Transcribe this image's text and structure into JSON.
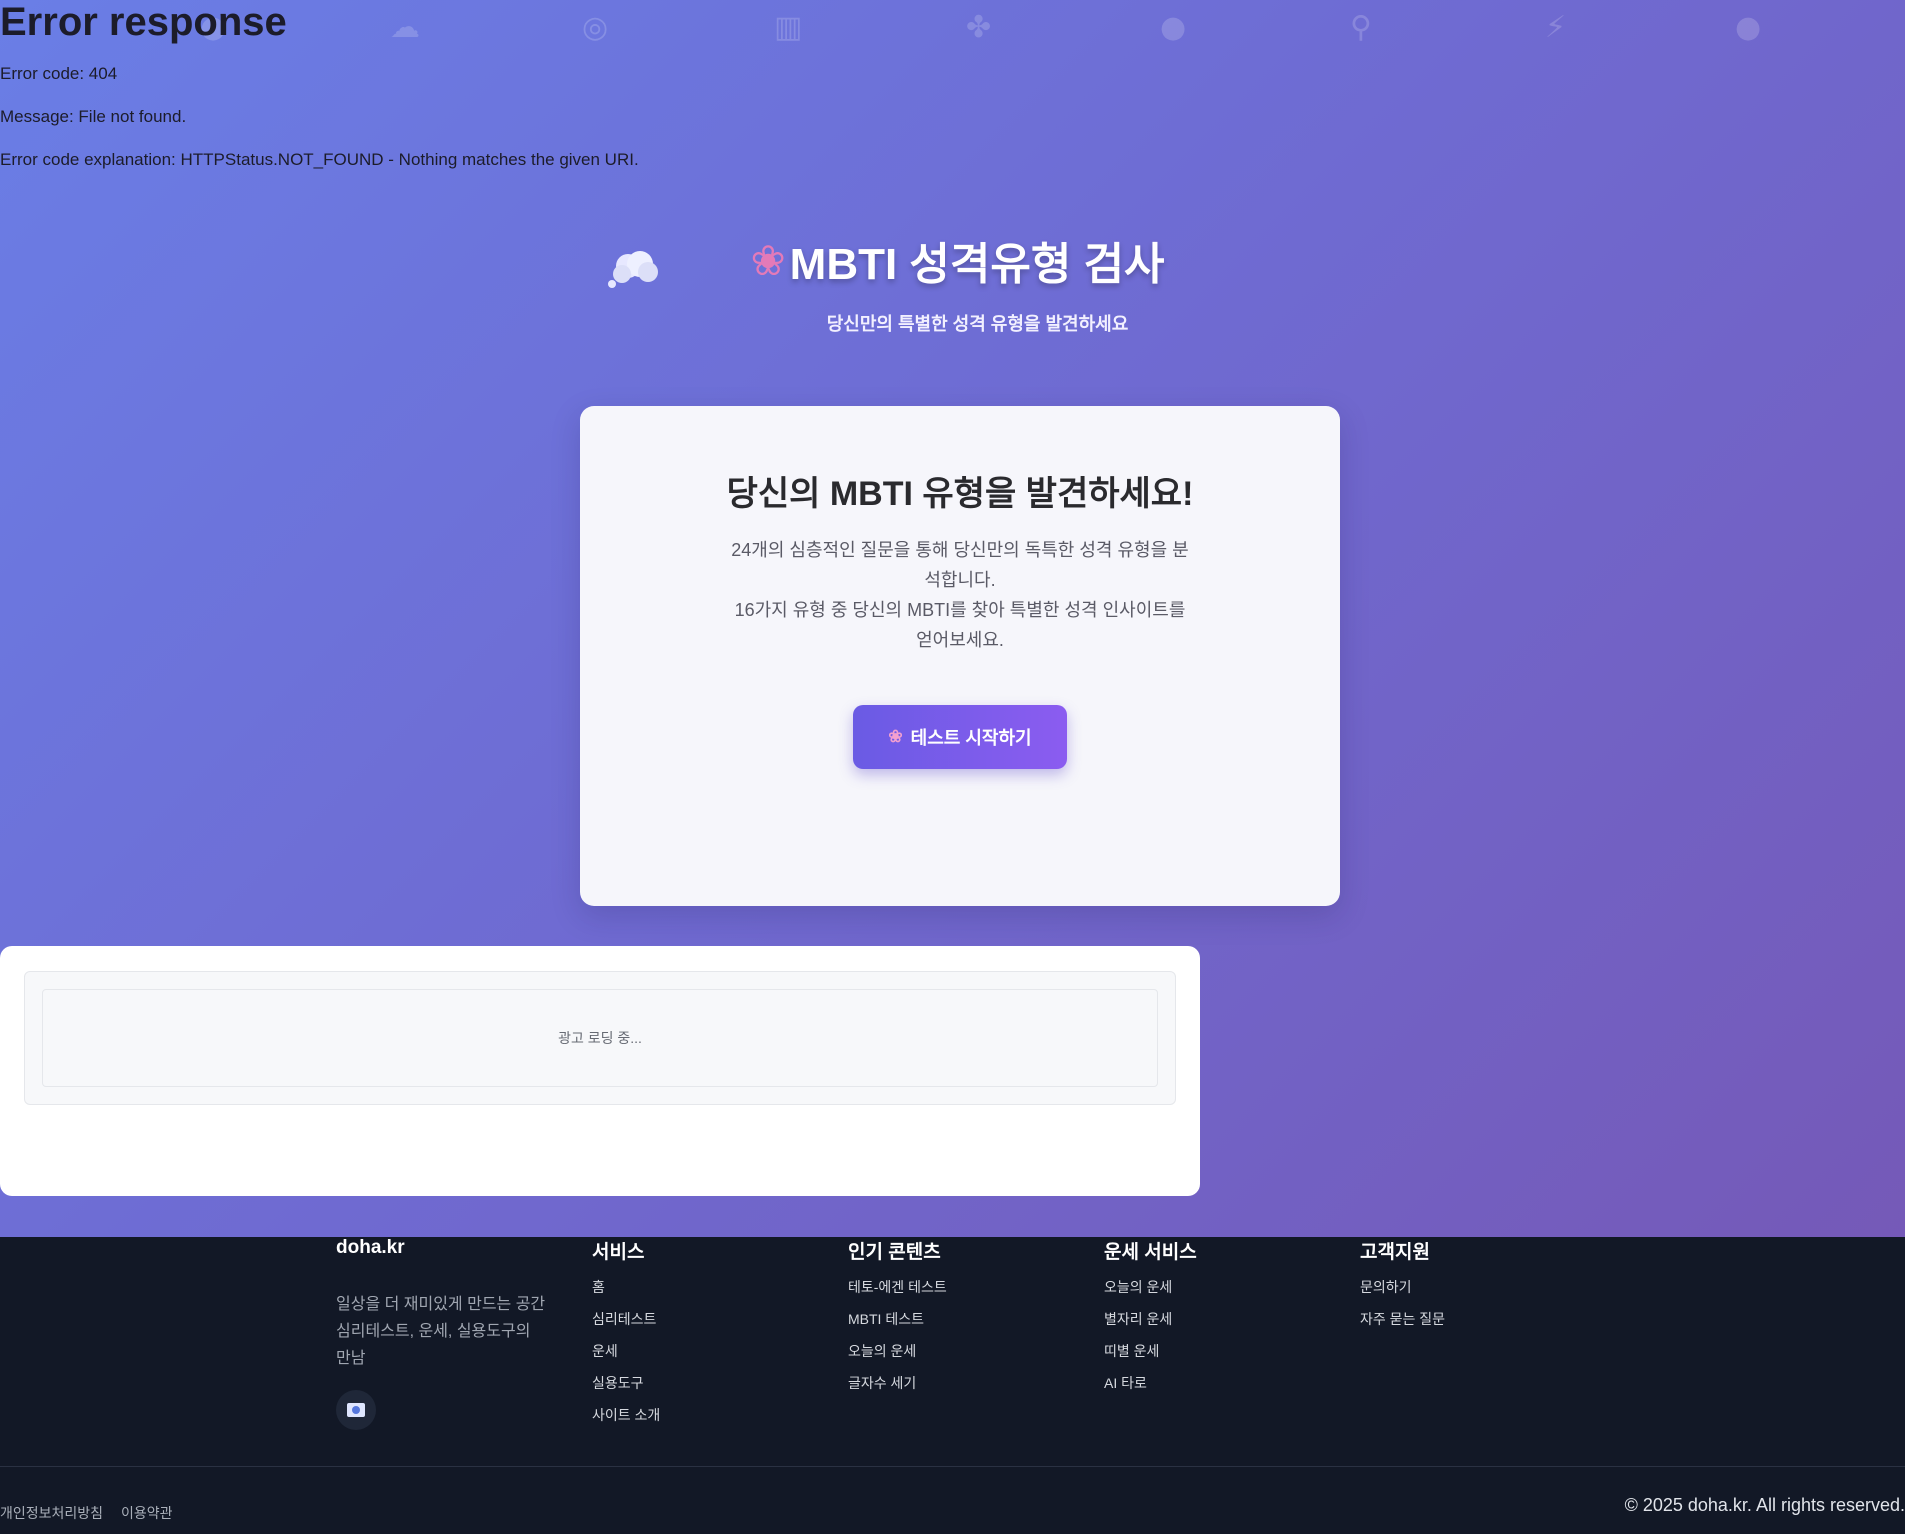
{
  "error": {
    "title": "Error response",
    "code_line": "Error code: 404",
    "message_line": "Message: File not found.",
    "explanation_line": "Error code explanation: HTTPStatus.NOT_FOUND - Nothing matches the given URI."
  },
  "bg_icons": [
    "brain-icon",
    "thought-icon",
    "target-icon",
    "chart-icon",
    "puzzle-icon",
    "bulb-icon",
    "magnifier-icon",
    "bolt-icon",
    "brain-icon"
  ],
  "hero": {
    "title": "MBTI 성격유형 검사",
    "subtitle": "당신만의 특별한 성격 유형을 발견하세요"
  },
  "card": {
    "title": "당신의 MBTI 유형을 발견하세요!",
    "desc_1": "24개의 심층적인 질문을 통해 당신만의 독특한 성격 유형을 분석합니다.",
    "desc_2": "16가지 유형 중 당신의 MBTI를 찾아 특별한 성격 인사이트를 얻어보세요.",
    "start_button": "테스트 시작하기"
  },
  "ad": {
    "loading_text": "광고 로딩 중..."
  },
  "footer": {
    "brand": "doha.kr",
    "brand_desc": "일상을 더 재미있게 만드는 공간 심리테스트, 운세, 실용도구의 만남",
    "columns": [
      {
        "title": "서비스",
        "links": [
          "홈",
          "심리테스트",
          "운세",
          "실용도구",
          "사이트 소개"
        ]
      },
      {
        "title": "인기 콘텐츠",
        "links": [
          "테토-에겐 테스트",
          "MBTI 테스트",
          "오늘의 운세",
          "글자수 세기"
        ]
      },
      {
        "title": "운세 서비스",
        "links": [
          "오늘의 운세",
          "별자리 운세",
          "띠별 운세",
          "AI 타로"
        ]
      },
      {
        "title": "고객지원",
        "links": [
          "문의하기",
          "자주 묻는 질문"
        ]
      }
    ],
    "legal": [
      "개인정보처리방침",
      "이용약관"
    ],
    "copyright": "© 2025 doha.kr. All rights reserved."
  },
  "colors": {
    "bg_start": "#6a7ee6",
    "bg_end": "#7656b3",
    "button_start": "#6a5be4",
    "button_end": "#8b5cf0",
    "footer_bg": "#121826"
  }
}
